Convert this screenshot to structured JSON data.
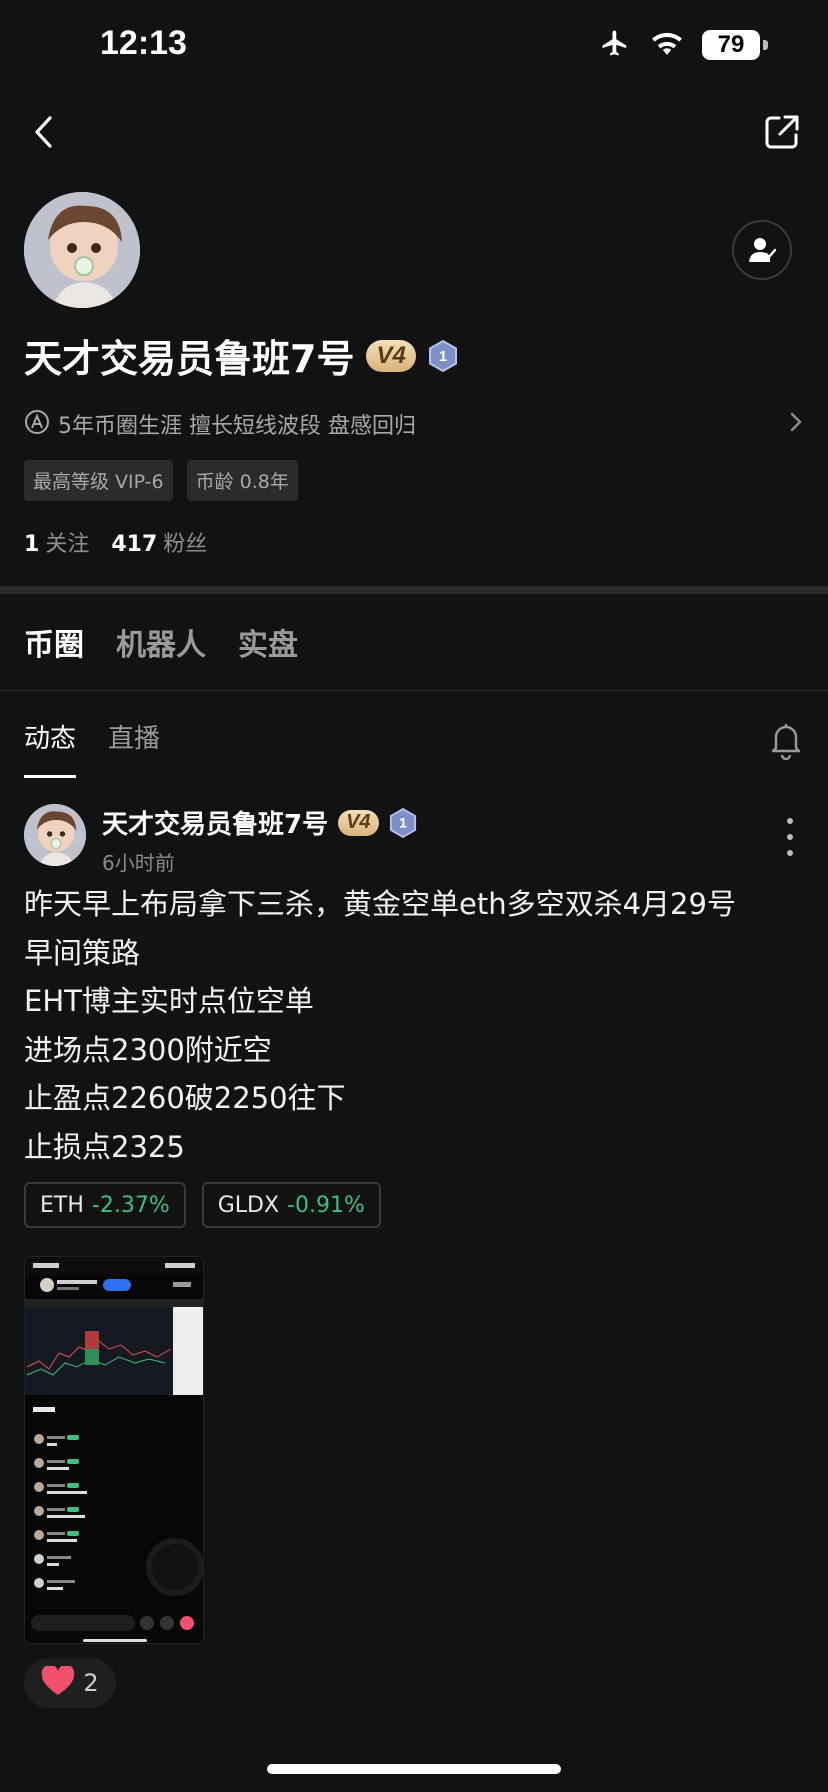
{
  "status_bar": {
    "time": "12:13",
    "battery": "79"
  },
  "profile": {
    "name": "天才交易员鲁班7号",
    "level_badge": "V4",
    "rank_badge": "1",
    "bio": "5年币圈生涯 擅长短线波段 盘感回归",
    "tags": [
      "最高等级 VIP-6",
      "币龄 0.8年"
    ],
    "following_count": "1",
    "following_label": "关注",
    "followers_count": "417",
    "followers_label": "粉丝"
  },
  "main_tabs": [
    {
      "label": "币圈",
      "active": true
    },
    {
      "label": "机器人",
      "active": false
    },
    {
      "label": "实盘",
      "active": false
    }
  ],
  "sub_tabs": [
    {
      "label": "动态",
      "active": true
    },
    {
      "label": "直播",
      "active": false
    }
  ],
  "post": {
    "author": "天才交易员鲁班7号",
    "level_badge": "V4",
    "rank_badge": "1",
    "time": "6小时前",
    "lines": [
      "昨天早上布局拿下三杀，黄金空单eth多空双杀4月29号",
      "早间策路",
      "EHT博主实时点位空单",
      "进场点2300附近空",
      "止盈点2260破2250往下",
      "止损点2325"
    ],
    "tickers": [
      {
        "symbol": "ETH",
        "change": "-2.37%"
      },
      {
        "symbol": "GLDX",
        "change": "-0.91%"
      }
    ],
    "likes": "2"
  },
  "colors": {
    "background": "#121212",
    "negative_change": "#3fbf7f",
    "badge_gold": "#e4c08e",
    "like_heart": "#f0506e"
  }
}
